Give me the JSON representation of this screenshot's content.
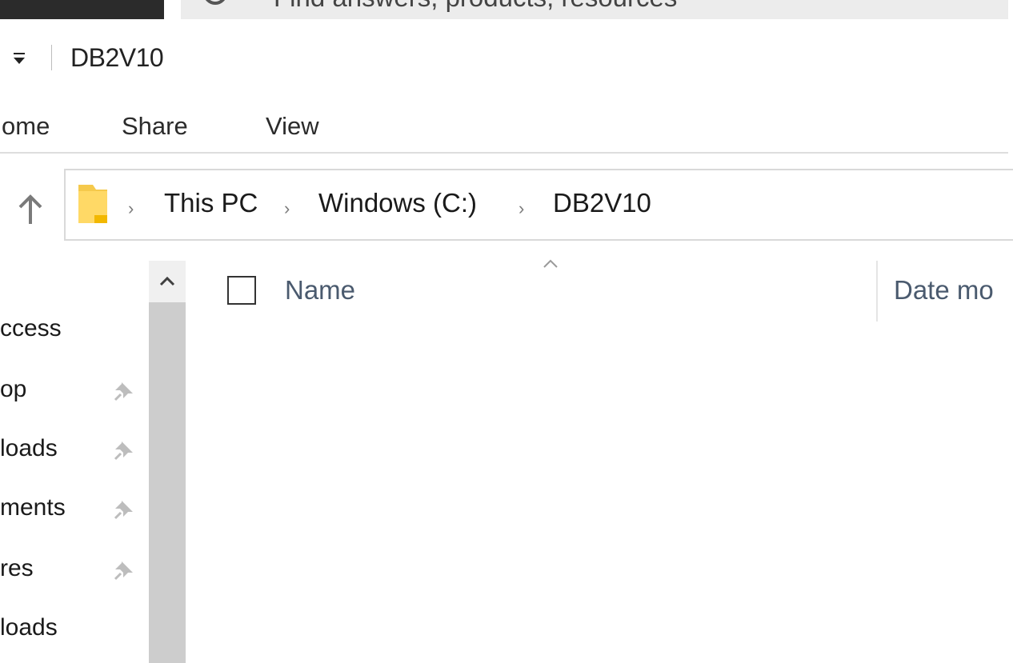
{
  "search": {
    "placeholder": "Find answers, products, resources"
  },
  "window": {
    "title": "DB2V10"
  },
  "ribbon": {
    "tabs": [
      {
        "label": "ome"
      },
      {
        "label": "Share"
      },
      {
        "label": "View"
      }
    ]
  },
  "address": {
    "crumbs": [
      "This PC",
      "Windows (C:)",
      "DB2V10"
    ],
    "separator": "›"
  },
  "nav": {
    "items": [
      {
        "label": "ccess",
        "pinned": false
      },
      {
        "label": "op",
        "pinned": true
      },
      {
        "label": "loads",
        "pinned": true
      },
      {
        "label": "ments",
        "pinned": true
      },
      {
        "label": "res",
        "pinned": true
      },
      {
        "label": "loads",
        "pinned": false
      }
    ]
  },
  "filelist": {
    "columns": [
      {
        "label": "Name"
      },
      {
        "label": "Date mo"
      }
    ]
  },
  "colors": {
    "scroll_thumb": "#cdcdcd",
    "folder": "#ffd966",
    "header_text": "#4a5a6e"
  }
}
